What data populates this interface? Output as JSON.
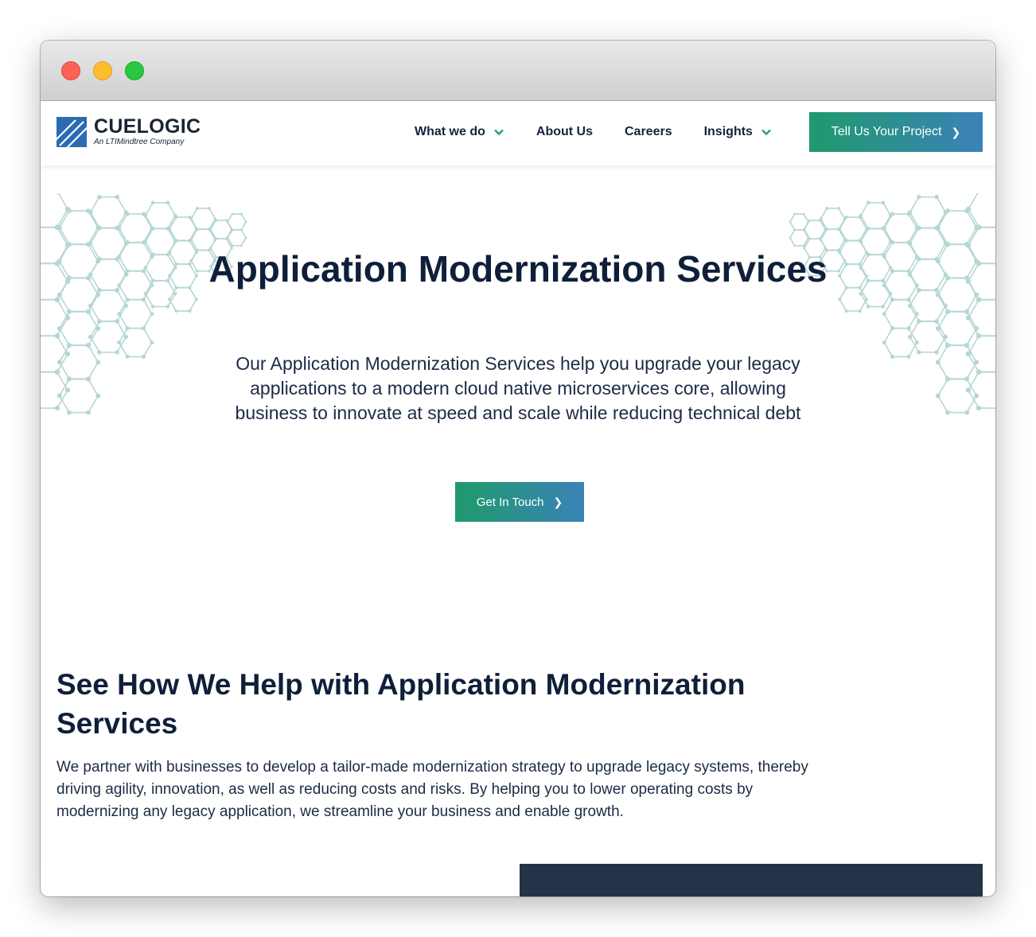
{
  "window": {
    "controls": [
      "close",
      "minimize",
      "maximize"
    ]
  },
  "brand": {
    "name": "CUELOGIC",
    "tagline": "An LTIMindtree Company",
    "logo_icon": "stripes-square-logo-icon"
  },
  "nav": {
    "items": [
      {
        "label": "What we do",
        "dropdown": true
      },
      {
        "label": "About Us",
        "dropdown": false
      },
      {
        "label": "Careers",
        "dropdown": false
      },
      {
        "label": "Insights",
        "dropdown": true
      }
    ],
    "cta_label": "Tell Us Your Project",
    "cta_arrow": "❯"
  },
  "hero": {
    "title": "Application Modernization Services",
    "subtitle": "Our Application Modernization Services help you upgrade your legacy applications to a modern cloud native microservices core, allowing business to innovate at speed and scale while reducing technical debt",
    "cta_label": "Get In Touch",
    "cta_arrow": "❯"
  },
  "section": {
    "title": "See How We Help with Application Modernization Services",
    "body": "We partner with businesses to develop a tailor-made modernization strategy to upgrade legacy systems, thereby driving agility, innovation, as well as reducing costs and risks. By helping you to lower operating costs by modernizing any legacy application, we streamline your business and enable growth."
  },
  "colors": {
    "accent_start": "#1f9a6c",
    "accent_end": "#3b82b8",
    "heading": "#0f1f3a",
    "hex_pattern": "#b7d6d6",
    "dark_block": "#243448"
  }
}
